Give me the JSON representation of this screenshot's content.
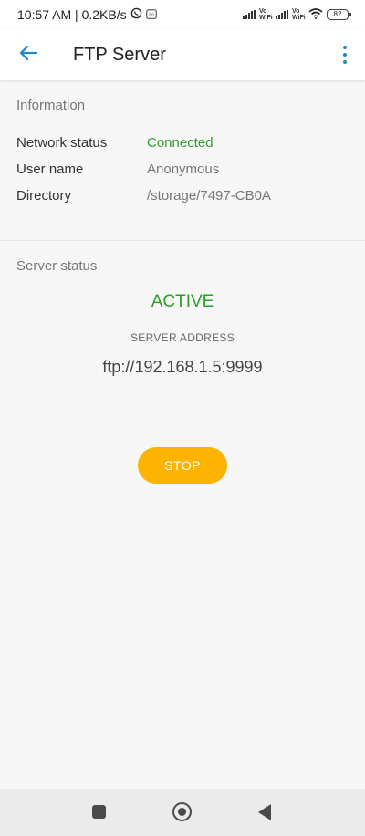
{
  "status_bar": {
    "time_speed": "10:57 AM | 0.2KB/s",
    "vowifi_1": "Vo WiFi",
    "vowifi_2": "Vo WiFi",
    "battery": "82"
  },
  "app_bar": {
    "title": "FTP Server"
  },
  "information": {
    "heading": "Information",
    "rows": [
      {
        "label": "Network status",
        "value": "Connected"
      },
      {
        "label": "User name",
        "value": "Anonymous"
      },
      {
        "label": "Directory",
        "value": "/storage/7497-CB0A"
      }
    ]
  },
  "server": {
    "heading": "Server status",
    "state": "ACTIVE",
    "address_label": "SERVER ADDRESS",
    "address": "ftp://192.168.1.5:9999",
    "stop_label": "STOP"
  },
  "colors": {
    "accent": "#1e88c8",
    "active_green": "#28a028",
    "stop_button": "#fcb400"
  },
  "icons": {
    "back": "arrow-left-icon",
    "menu": "more-vert-icon",
    "whatsapp": "whatsapp-icon",
    "notification": "m-notification-icon",
    "signal": "signal-icon",
    "wifi": "wifi-icon",
    "battery": "battery-icon",
    "nav_recents": "square-icon",
    "nav_home": "home-circle-icon",
    "nav_back": "triangle-back-icon"
  }
}
